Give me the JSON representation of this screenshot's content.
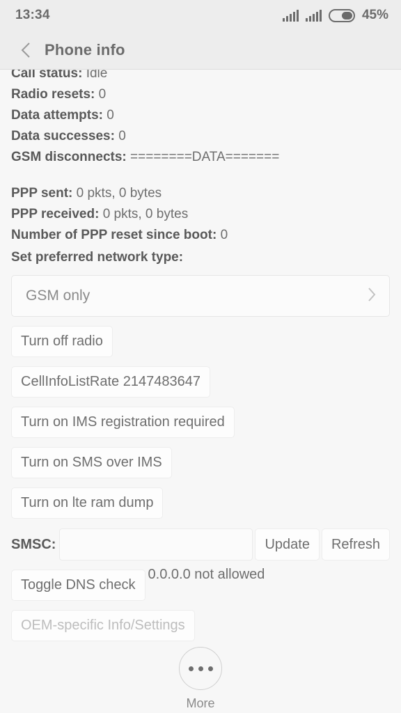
{
  "status_bar": {
    "time": "13:34",
    "battery_percent": "45%",
    "battery_level": 45,
    "signal_icons": [
      "signal-bars-icon",
      "signal-bars-icon"
    ],
    "battery_icon": "battery-icon"
  },
  "app_bar": {
    "back_icon": "chevron-left-icon",
    "title": "Phone info"
  },
  "info_lines": [
    {
      "label": "Call status:",
      "value": "Idle"
    },
    {
      "label": "Radio resets:",
      "value": "0"
    },
    {
      "label": "Data attempts:",
      "value": "0"
    },
    {
      "label": "Data successes:",
      "value": "0"
    },
    {
      "label": "GSM disconnects:",
      "value": "========DATA======="
    }
  ],
  "ppp_lines": [
    {
      "label": "PPP sent:",
      "value": "0 pkts, 0 bytes"
    },
    {
      "label": "PPP received:",
      "value": "0 pkts, 0 bytes"
    },
    {
      "label": "Number of PPP reset since boot:",
      "value": "0"
    }
  ],
  "network": {
    "label": "Set preferred network type:",
    "selected": "GSM only",
    "chevron_icon": "chevron-right-icon"
  },
  "buttons": [
    {
      "label": "Turn off radio",
      "disabled": false
    },
    {
      "label": "CellInfoListRate 2147483647",
      "disabled": false
    },
    {
      "label": "Turn on IMS registration required",
      "disabled": false
    },
    {
      "label": "Turn on SMS over IMS",
      "disabled": false
    },
    {
      "label": "Turn on lte ram dump",
      "disabled": false
    }
  ],
  "smsc": {
    "label": "SMSC:",
    "value": "",
    "placeholder": "",
    "update_label": "Update",
    "refresh_label": "Refresh"
  },
  "dns": {
    "toggle_label": "Toggle DNS check",
    "status": "0.0.0.0 not allowed"
  },
  "oem": {
    "label": "OEM-specific Info/Settings",
    "disabled": true
  },
  "more": {
    "icon": "more-dots-icon",
    "label": "More"
  },
  "colors": {
    "page_bg": "#f7f7f7",
    "bar_bg": "#ededed",
    "text": "#6e6e6e",
    "text_strong": "#595959",
    "muted": "#bdbdbd",
    "border": "#ededed"
  }
}
